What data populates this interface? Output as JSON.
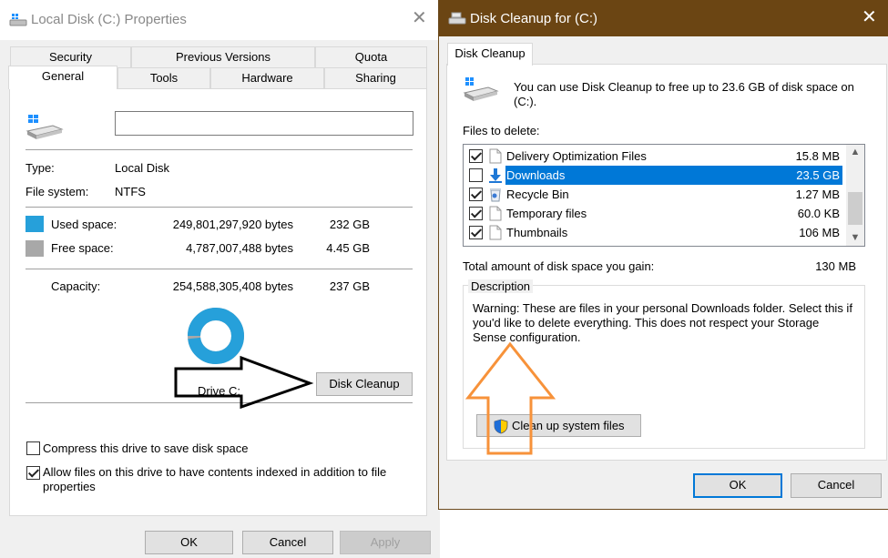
{
  "properties": {
    "title": "Local Disk (C:) Properties",
    "tabs_top": [
      "Security",
      "Previous Versions",
      "Quota"
    ],
    "tabs_bottom": [
      "General",
      "Tools",
      "Hardware",
      "Sharing"
    ],
    "active_tab": "General",
    "volume_name_value": "",
    "type_label": "Type:",
    "type_value": "Local Disk",
    "fs_label": "File system:",
    "fs_value": "NTFS",
    "used_label": "Used space:",
    "used_bytes": "249,801,297,920 bytes",
    "used_gb": "232 GB",
    "free_label": "Free space:",
    "free_bytes": "4,787,007,488 bytes",
    "free_gb": "4.45 GB",
    "capacity_label": "Capacity:",
    "capacity_bytes": "254,588,305,408 bytes",
    "capacity_gb": "237 GB",
    "drive_label": "Drive C:",
    "disk_cleanup_button": "Disk Cleanup",
    "compress_label": "Compress this drive to save disk space",
    "compress_checked": false,
    "index_label": "Allow files on this drive to have contents indexed in addition to file properties",
    "index_checked": true,
    "ok_button": "OK",
    "cancel_button": "Cancel",
    "apply_button": "Apply",
    "colors": {
      "used": "#26a0da",
      "free": "#a8a8a8"
    },
    "used_fraction": 0.981
  },
  "cleanup": {
    "title": "Disk Cleanup for  (C:)",
    "tab": "Disk Cleanup",
    "intro": "You can use Disk Cleanup to free up to 23.6 GB of disk space on (C:).",
    "files_label": "Files to delete:",
    "files": [
      {
        "name": "Delivery Optimization Files",
        "size": "15.8 MB",
        "checked": true,
        "selected": false,
        "icon": "file-icon"
      },
      {
        "name": "Downloads",
        "size": "23.5 GB",
        "checked": false,
        "selected": true,
        "icon": "download-icon"
      },
      {
        "name": "Recycle Bin",
        "size": "1.27 MB",
        "checked": true,
        "selected": false,
        "icon": "recycle-bin-icon"
      },
      {
        "name": "Temporary files",
        "size": "60.0 KB",
        "checked": true,
        "selected": false,
        "icon": "file-icon"
      },
      {
        "name": "Thumbnails",
        "size": "106 MB",
        "checked": true,
        "selected": false,
        "icon": "file-icon"
      }
    ],
    "total_label": "Total amount of disk space you gain:",
    "total_value": "130 MB",
    "description_label": "Description",
    "description_text": "Warning: These are files in your personal Downloads folder. Select this if you'd like to delete everything. This does not respect your Storage Sense configuration.",
    "cleanup_system_button": "Clean up system files",
    "ok_button": "OK",
    "cancel_button": "Cancel"
  },
  "annotations": {
    "arrow_right_color": "#000000",
    "arrow_up_color": "#f7923a"
  }
}
